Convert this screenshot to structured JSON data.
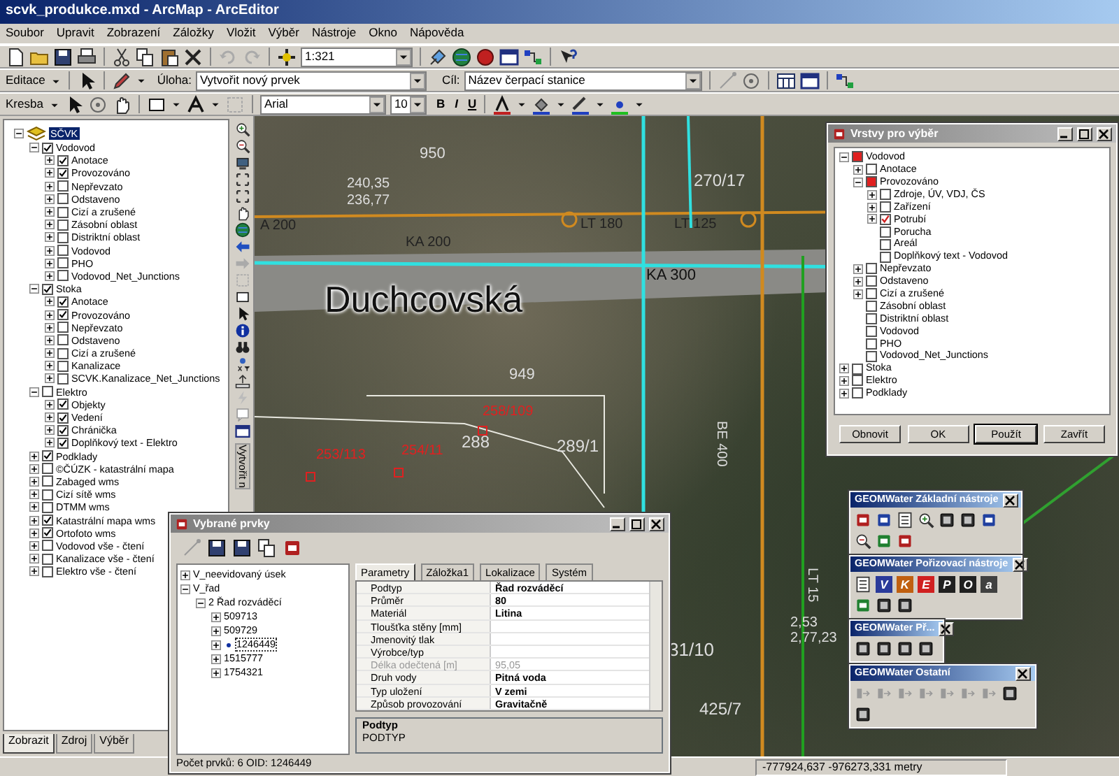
{
  "window": {
    "title": "scvk_produkce.mxd - ArcMap - ArcEditor"
  },
  "menu": [
    "Soubor",
    "Upravit",
    "Zobrazení",
    "Záložky",
    "Vložit",
    "Výběr",
    "Nástroje",
    "Okno",
    "Nápověda"
  ],
  "standard_toolbar": {
    "scale": "1:321"
  },
  "editor_toolbar": {
    "menu": "Editace",
    "task_label": "Úloha:",
    "task": "Vytvořit nový prvek",
    "target_label": "Cíl:",
    "target": "Název čerpací stanice"
  },
  "draw_toolbar": {
    "menu": "Kresba",
    "font": "Arial",
    "size": "10",
    "bold": "B",
    "italic": "I",
    "underline": "U"
  },
  "toc": {
    "root": {
      "label": "SČVK",
      "expanded": true,
      "selected": true
    },
    "groups": [
      {
        "label": "Vodovod",
        "checked": true,
        "expanded": true,
        "children": [
          {
            "label": "Anotace",
            "checked": true,
            "expanded": false
          },
          {
            "label": "Provozováno",
            "checked": true,
            "expanded": false
          },
          {
            "label": "Nepřevzato",
            "checked": false,
            "expanded": false
          },
          {
            "label": "Odstaveno",
            "checked": false,
            "expanded": false
          },
          {
            "label": "Cizí a zrušené",
            "checked": false,
            "expanded": false
          },
          {
            "label": "Zásobní oblast",
            "checked": false,
            "expanded": false
          },
          {
            "label": "Distriktní oblast",
            "checked": false,
            "expanded": false
          },
          {
            "label": "Vodovod",
            "checked": false,
            "expanded": false
          },
          {
            "label": "PHO",
            "checked": false,
            "expanded": false
          },
          {
            "label": "Vodovod_Net_Junctions",
            "checked": false,
            "expanded": false
          }
        ]
      },
      {
        "label": "Stoka",
        "checked": true,
        "expanded": true,
        "children": [
          {
            "label": "Anotace",
            "checked": true,
            "expanded": false
          },
          {
            "label": "Provozováno",
            "checked": true,
            "expanded": false
          },
          {
            "label": "Nepřevzato",
            "checked": false,
            "expanded": false
          },
          {
            "label": "Odstaveno",
            "checked": false,
            "expanded": false
          },
          {
            "label": "Cizí a zrušené",
            "checked": false,
            "expanded": false
          },
          {
            "label": "Kanalizace",
            "checked": false,
            "expanded": false
          },
          {
            "label": "SCVK.Kanalizace_Net_Junctions",
            "checked": false,
            "expanded": false
          }
        ]
      },
      {
        "label": "Elektro",
        "checked": false,
        "expanded": true,
        "children": [
          {
            "label": "Objekty",
            "checked": true,
            "expanded": false
          },
          {
            "label": "Vedení",
            "checked": true,
            "expanded": false
          },
          {
            "label": "Chránička",
            "checked": true,
            "expanded": false
          },
          {
            "label": "Doplňkový text - Elektro",
            "checked": true,
            "expanded": false
          }
        ]
      },
      {
        "label": "Podklady",
        "checked": true,
        "expanded": false
      },
      {
        "label": "©ČÚZK - katastrální mapa",
        "checked": false,
        "expanded": false
      },
      {
        "label": "Zabaged wms",
        "checked": false,
        "expanded": false
      },
      {
        "label": "Cizí sítě wms",
        "checked": false,
        "expanded": false
      },
      {
        "label": "DTMM wms",
        "checked": false,
        "expanded": false
      },
      {
        "label": "Katastrální mapa wms",
        "checked": true,
        "expanded": false
      },
      {
        "label": "Ortofoto wms",
        "checked": true,
        "expanded": false
      },
      {
        "label": "Vodovod vše - čtení",
        "checked": false,
        "expanded": false
      },
      {
        "label": "Kanalizace vše - čtení",
        "checked": false,
        "expanded": false
      },
      {
        "label": "Elektro vše - čtení",
        "checked": false,
        "expanded": false
      }
    ],
    "tabs": [
      {
        "label": "Zobrazit",
        "selected": true
      },
      {
        "label": "Zdroj",
        "selected": false
      },
      {
        "label": "Výběr",
        "selected": false
      }
    ]
  },
  "tool_strip": {
    "caption": "Vytvořit n"
  },
  "map": {
    "labels": [
      {
        "text": "Duchcovská",
        "color": "#111111"
      },
      {
        "text": "KA 300",
        "color": "#111111"
      },
      {
        "text": "KA 200",
        "color": "#222222"
      },
      {
        "text": "A 200",
        "color": "#222222"
      },
      {
        "text": "LT 180",
        "color": "#222222"
      },
      {
        "text": "LT 125",
        "color": "#222222"
      },
      {
        "text": "240,35",
        "color": "#dddddd"
      },
      {
        "text": "236,77",
        "color": "#dddddd"
      },
      {
        "text": "950",
        "color": "#dddddd"
      },
      {
        "text": "270/17",
        "color": "#dddddd"
      },
      {
        "text": "949",
        "color": "#dddddd"
      },
      {
        "text": "258/109",
        "color": "#e02020"
      },
      {
        "text": "253/113",
        "color": "#e02020"
      },
      {
        "text": "254/11",
        "color": "#e02020"
      },
      {
        "text": "288",
        "color": "#dddddd"
      },
      {
        "text": "289/1",
        "color": "#dddddd"
      },
      {
        "text": "BE 400",
        "color": "#dddddd"
      },
      {
        "text": "LT 15",
        "color": "#dddddd"
      },
      {
        "text": "2,53",
        "color": "#dddddd"
      },
      {
        "text": "2,77,23",
        "color": "#dddddd"
      },
      {
        "text": "31/10",
        "color": "#dddddd"
      },
      {
        "text": "425/7",
        "color": "#dddddd"
      }
    ]
  },
  "selection_layers_dialog": {
    "title": "Vrstvy pro výběr",
    "tree": [
      {
        "label": "Vodovod",
        "checked": false,
        "partial": true,
        "expanded": true,
        "children": [
          {
            "label": "Anotace",
            "checked": false,
            "partial": false,
            "expanded": false
          },
          {
            "label": "Provozováno",
            "checked": false,
            "partial": true,
            "expanded": true,
            "children": [
              {
                "label": "Zdroje, ÚV, VDJ, ČS",
                "checked": false,
                "partial": false,
                "expanded": false
              },
              {
                "label": "Zařízení",
                "checked": false,
                "partial": false,
                "expanded": false
              },
              {
                "label": "Potrubí",
                "checked": true,
                "partial": false,
                "expanded": false
              },
              {
                "label": "Porucha",
                "checked": false,
                "partial": false
              },
              {
                "label": "Areál",
                "checked": false,
                "partial": false
              },
              {
                "label": "Doplňkový text - Vodovod",
                "checked": false,
                "partial": false
              }
            ]
          },
          {
            "label": "Nepřevzato",
            "checked": false,
            "partial": false,
            "expanded": false
          },
          {
            "label": "Odstaveno",
            "checked": false,
            "partial": false,
            "expanded": false
          },
          {
            "label": "Cizí a zrušené",
            "checked": false,
            "partial": false,
            "expanded": false
          },
          {
            "label": "Zásobní oblast",
            "checked": false,
            "partial": false
          },
          {
            "label": "Distriktní oblast",
            "checked": false,
            "partial": false
          },
          {
            "label": "Vodovod",
            "checked": false,
            "partial": false
          },
          {
            "label": "PHO",
            "checked": false,
            "partial": false
          },
          {
            "label": "Vodovod_Net_Junctions",
            "checked": false,
            "partial": false
          }
        ]
      },
      {
        "label": "Stoka",
        "checked": false,
        "partial": false,
        "expanded": false
      },
      {
        "label": "Elektro",
        "checked": false,
        "partial": false,
        "expanded": false
      },
      {
        "label": "Podklady",
        "checked": false,
        "partial": false,
        "expanded": false
      }
    ],
    "buttons": [
      {
        "label": "Obnovit",
        "default": false
      },
      {
        "label": "OK",
        "default": false
      },
      {
        "label": "Použít",
        "default": true
      },
      {
        "label": "Zavřít",
        "default": false
      }
    ]
  },
  "selected_features": {
    "title": "Vybrané prvky",
    "tree": [
      {
        "label": "V_neevidovaný úsek",
        "expanded": false,
        "selected": false
      },
      {
        "label": "V_řad",
        "expanded": true,
        "selected": false,
        "children": [
          {
            "label": "2 Řad rozváděcí",
            "expanded": true,
            "selected": false,
            "children": [
              {
                "label": "509713",
                "expanded": false,
                "selected": false
              },
              {
                "label": "509729",
                "expanded": false,
                "selected": false
              },
              {
                "label": "1246449",
                "expanded": false,
                "selected": true
              },
              {
                "label": "1515777",
                "expanded": false,
                "selected": false
              },
              {
                "label": "1754321",
                "expanded": false,
                "selected": false
              }
            ]
          }
        ]
      }
    ],
    "tabs": [
      {
        "label": "Parametry",
        "selected": true
      },
      {
        "label": "Záložka1",
        "selected": false
      },
      {
        "label": "Lokalizace",
        "selected": false
      },
      {
        "label": "Systém",
        "selected": false
      }
    ],
    "properties": [
      {
        "name": "Podtyp",
        "value": "Řad rozváděcí",
        "disabled": false
      },
      {
        "name": "Průměr",
        "value": "80",
        "disabled": false
      },
      {
        "name": "Materiál",
        "value": "Litina",
        "disabled": false
      },
      {
        "name": "Tloušťka stěny [mm]",
        "disabled": false
      },
      {
        "name": "Jmenovitý tlak",
        "disabled": false
      },
      {
        "name": "Výrobce/typ",
        "disabled": false
      },
      {
        "name": "Délka odečtená [m]",
        "value": "95,05",
        "disabled": true
      },
      {
        "name": "Druh vody",
        "value": "Pitná voda",
        "disabled": false
      },
      {
        "name": "Typ uložení",
        "value": "V zemi",
        "disabled": false
      },
      {
        "name": "Způsob provozování",
        "value": "Gravitačně",
        "disabled": false
      }
    ],
    "description": {
      "title": "Podtyp",
      "text": "PODTYP"
    },
    "status": "Počet prvků: 6  OID: 1246449"
  },
  "geomwater_toolbars": [
    {
      "title": "GEOMWater Základní nástroje"
    },
    {
      "title": "GEOMWater Pořizovací nástroje",
      "letter_buttons": [
        {
          "text": "V",
          "color": "#2a3a9a"
        },
        {
          "text": "K",
          "color": "#c06010"
        },
        {
          "text": "E",
          "color": "#d02020"
        },
        {
          "text": "P",
          "color": "#202020"
        },
        {
          "text": "O",
          "color": "#202020"
        },
        {
          "text": "a",
          "color": "#404040"
        }
      ]
    },
    {
      "title": "GEOMWater Př..."
    },
    {
      "title": "GEOMWater Ostatní"
    }
  ],
  "status_bar": {
    "coordinates": "-777924,637  -976273,331 metry"
  }
}
